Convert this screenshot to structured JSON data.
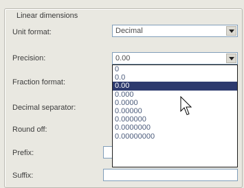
{
  "group": {
    "title": "Linear dimensions"
  },
  "fields": {
    "unit_format": {
      "label": "Unit format:",
      "value": "Decimal"
    },
    "precision": {
      "label": "Precision:",
      "value": "0.00"
    },
    "fraction_format": {
      "label": "Fraction format:"
    },
    "decimal_separator": {
      "label": "Decimal separator:"
    },
    "round_off": {
      "label": "Round off:"
    },
    "prefix": {
      "label": "Prefix:",
      "value": ""
    },
    "suffix": {
      "label": "Suffix:",
      "value": ""
    }
  },
  "precision_options": [
    "0",
    "0.0",
    "0.00",
    "0.000",
    "0.0000",
    "0.00000",
    "0.000000",
    "0.0000000",
    "0.00000000"
  ],
  "selected_option_index": 2,
  "icons": {
    "dropdown": "chevron-down-icon",
    "pointer": "mouse-pointer-icon"
  }
}
